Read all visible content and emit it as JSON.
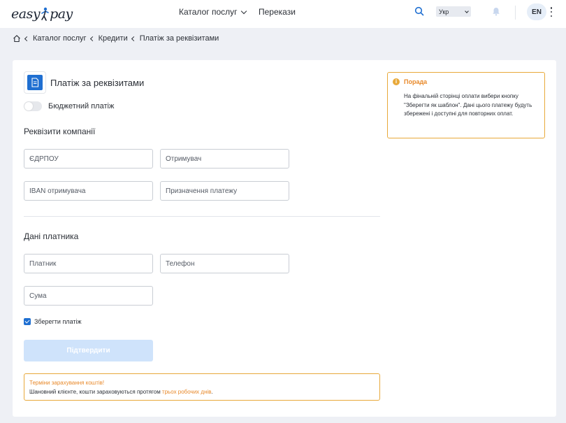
{
  "header": {
    "logo_part1": "easy",
    "logo_part2": "pay",
    "nav": [
      {
        "label": "Каталог послуг"
      },
      {
        "label": "Перекази"
      }
    ],
    "language_select": "Укр",
    "language_button": "EN"
  },
  "breadcrumb": {
    "items": [
      "Каталог послуг",
      "Кредити",
      "Платіж за реквізитами"
    ]
  },
  "form": {
    "title": "Платіж за реквізитами",
    "budget_toggle_label": "Бюджетний платіж",
    "company_section": "Реквізити компанії",
    "company_fields": {
      "edrpou": "ЄДРПОУ",
      "recipient": "Отримувач",
      "iban": "IBAN отримувача",
      "purpose": "Призначення платежу"
    },
    "payer_section": "Дані платника",
    "payer_fields": {
      "payer": "Платник",
      "phone": "Телефон",
      "amount": "Сума"
    },
    "save_checkbox_label": "Зберегти платіж",
    "save_checked": true,
    "confirm_button": "Підтвердити",
    "notice": {
      "title": "Терміни зарахування коштів!",
      "text": "Шановний клієнте, кошти зараховуються протягом ",
      "highlight": "трьох робочих днів",
      "end": "."
    }
  },
  "tip": {
    "title": "Порада",
    "text": "На фінальній сторінці оплати вибери кнопку \"Зберегти як шаблон\". Дані цього платежу будуть збережені і доступні для повторних оплат."
  },
  "colors": {
    "accent": "#1f6fd1",
    "warning": "#e8a93a",
    "button_disabled": "#cfe3fb"
  }
}
